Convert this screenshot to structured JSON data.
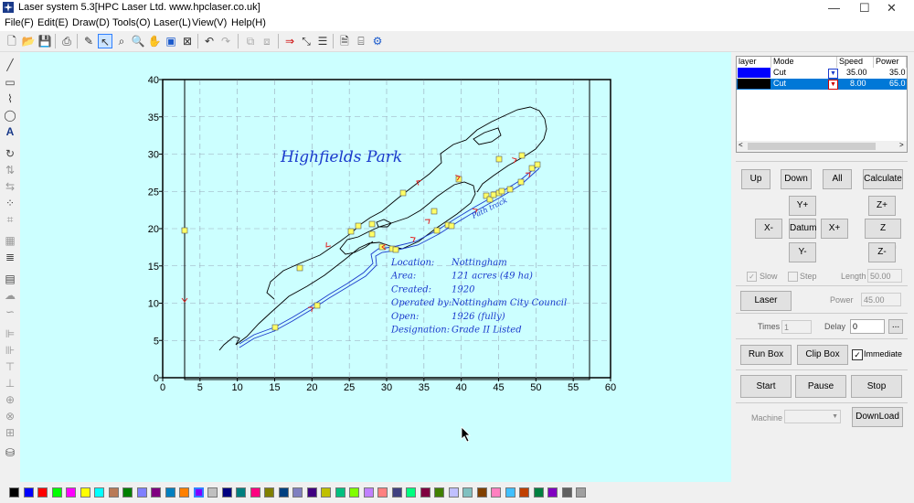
{
  "window": {
    "title": "Laser system 5.3[HPC Laser Ltd. www.hpclaser.co.uk]",
    "minimize": "—",
    "maximize": "☐",
    "close": "✕"
  },
  "menu": [
    "File(F)",
    "Edit(E)",
    "Draw(D)",
    "Tools(O)",
    "Laser(L)",
    "View(V)",
    "Help(H)"
  ],
  "layers": {
    "headers": [
      "layer",
      "Mode",
      "Speed",
      "Power"
    ],
    "rows": [
      {
        "color": "#0000ff",
        "mode": "Cut",
        "speed": "35.00",
        "power": "35.0",
        "selected": false
      },
      {
        "color": "#000000",
        "mode": "Cut",
        "speed": "8.00",
        "power": "65.0",
        "selected": true
      }
    ]
  },
  "controls": {
    "up": "Up",
    "down": "Down",
    "all": "All",
    "calculate": "Calculate",
    "y_plus": "Y+",
    "z_plus": "Z+",
    "x_minus": "X-",
    "datum": "Datum",
    "x_plus": "X+",
    "z_datum": "Z Datum",
    "y_minus": "Y-",
    "z_minus": "Z-",
    "slow": "Slow",
    "step": "Step",
    "length_label": "Length",
    "length_value": "50.00",
    "laser": "Laser",
    "power_label": "Power",
    "power_value": "45.00",
    "times_label": "Times",
    "times_value": "1",
    "delay_label": "Delay",
    "delay_value": "0",
    "ellipsis": "...",
    "run_box": "Run Box",
    "clip_box": "Clip Box",
    "immediate": "Immediate",
    "start": "Start",
    "pause": "Pause",
    "stop": "Stop",
    "machine_label": "Machine",
    "download": "DownLoad"
  },
  "drawing": {
    "title": "Highfields Park",
    "path_label": "Path track",
    "info": [
      {
        "label": "Location:",
        "value": "Nottingham"
      },
      {
        "label": "Area:",
        "value": "121 acres (49 ha)"
      },
      {
        "label": "Created:",
        "value": "1920"
      },
      {
        "label": "Operated by:",
        "value": "Nottingham City Council"
      },
      {
        "label": "Open:",
        "value": "1926 (fully)"
      },
      {
        "label": "Designation:",
        "value": "Grade II Listed"
      }
    ]
  },
  "chart_data": {
    "type": "scatter",
    "xlim": [
      0,
      60
    ],
    "ylim": [
      0,
      40
    ],
    "grid": true,
    "x_ticks": [
      "0",
      "5",
      "10",
      "15",
      "20",
      "25",
      "30",
      "35",
      "40",
      "45",
      "50",
      "55",
      "60"
    ],
    "y_ticks": [
      "0",
      "5",
      "10",
      "15",
      "20",
      "25",
      "30",
      "35",
      "40"
    ]
  },
  "palette": [
    "#000000",
    "#0000ff",
    "#ff0000",
    "#00ff00",
    "#ff00ff",
    "#ffff00",
    "#00ffff",
    "#b97a57",
    "#008000",
    "#8080ff",
    "#800080",
    "#0080c0",
    "#ff8000",
    "#8000ff",
    "#c0c0c0",
    "#000080",
    "#008080",
    "#ff0080",
    "#808000",
    "#004080",
    "#8080c0",
    "#400080",
    "#c0c000",
    "#00c080",
    "#80ff00",
    "#c080ff",
    "#ff8080",
    "#404080",
    "#00ff80",
    "#800040",
    "#408000",
    "#c0c0ff",
    "#80c0c0",
    "#804000",
    "#ff80c0",
    "#40c0ff",
    "#c04000",
    "#008040",
    "#8000c0",
    "#606060",
    "#a0a0a0"
  ]
}
